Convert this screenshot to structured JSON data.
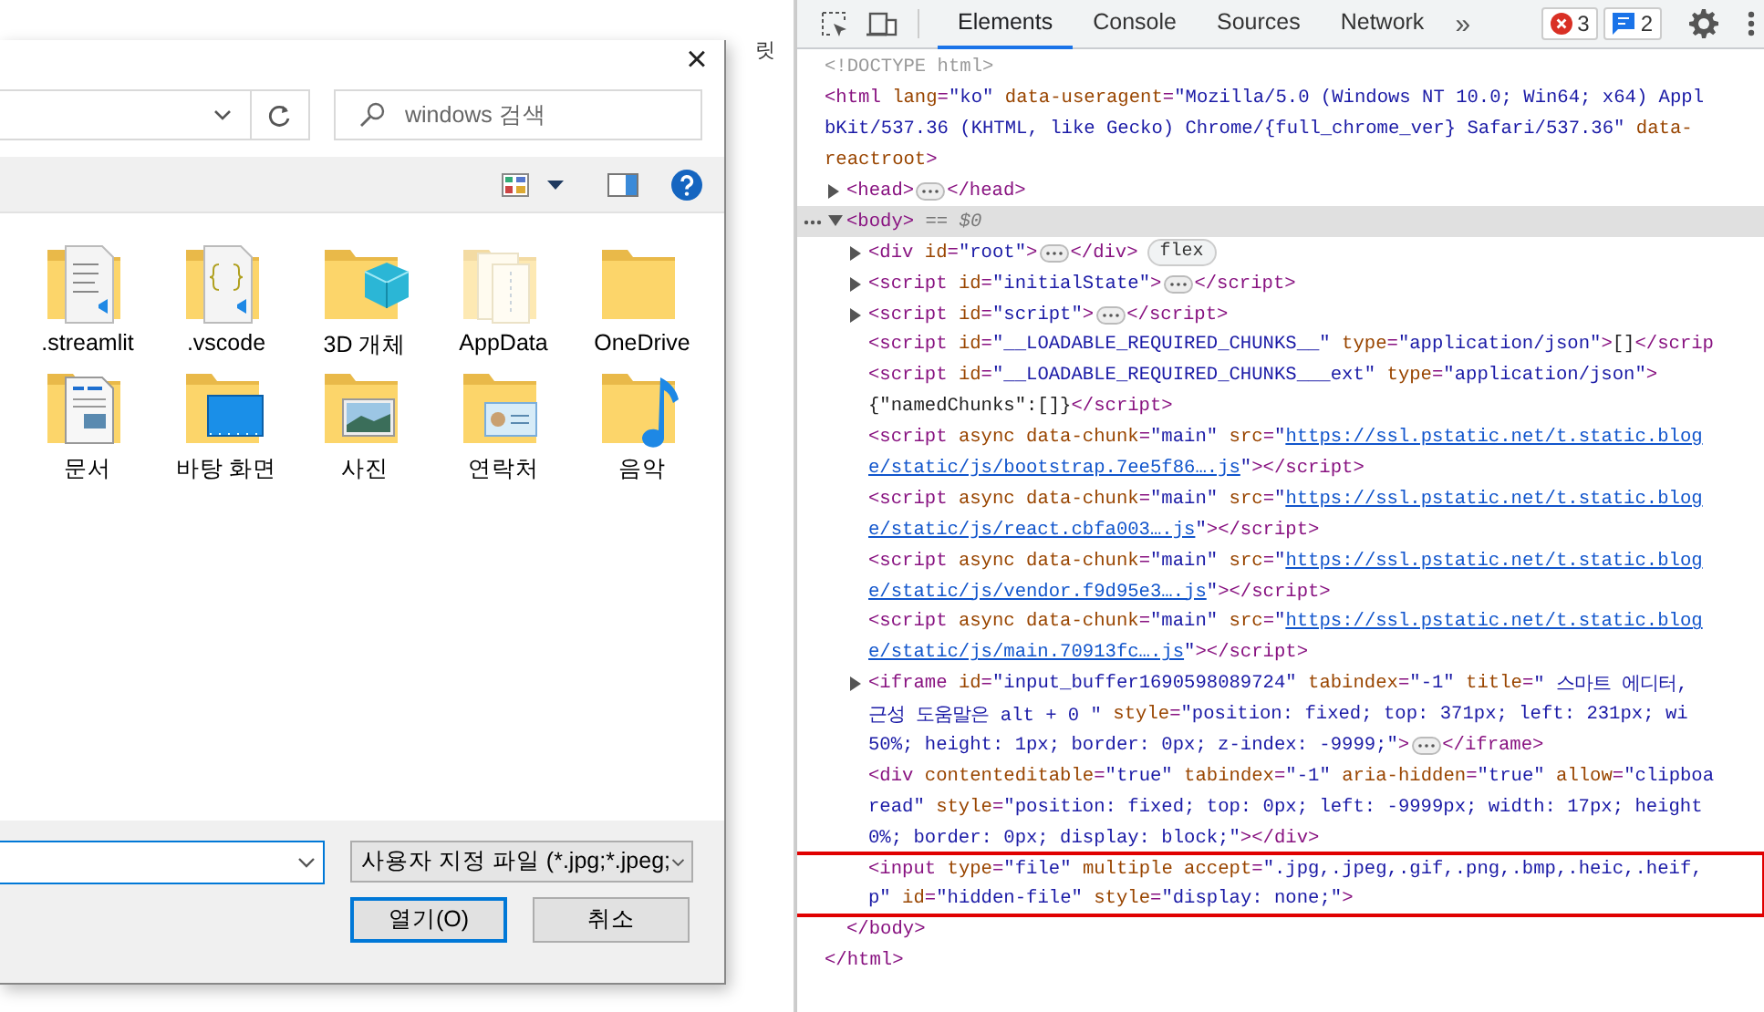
{
  "background_page": {
    "fragments": [
      "릿"
    ]
  },
  "file_dialog": {
    "close_label": "×",
    "search": {
      "placeholder": "windows 검색"
    },
    "items": [
      {
        "label": ".streamlit",
        "kind": "doc-badge",
        "hidden": false
      },
      {
        "label": ".vscode",
        "kind": "braces",
        "hidden": false
      },
      {
        "label": "3D 개체",
        "kind": "cube",
        "hidden": false
      },
      {
        "label": "AppData",
        "kind": "pages",
        "hidden": true
      },
      {
        "label": "OneDrive",
        "kind": "plain",
        "hidden": false
      },
      {
        "label": "문서",
        "kind": "document",
        "hidden": false
      },
      {
        "label": "바탕 화면",
        "kind": "desktop",
        "hidden": false
      },
      {
        "label": "사진",
        "kind": "picture",
        "hidden": false
      },
      {
        "label": "연락처",
        "kind": "contact",
        "hidden": false
      },
      {
        "label": "음악",
        "kind": "music",
        "hidden": false
      }
    ],
    "file_type": "사용자 지정 파일 (*.jpg;*.jpeg;",
    "buttons": [
      {
        "label": "열기(O)",
        "default": true
      },
      {
        "label": "취소",
        "default": false
      }
    ]
  },
  "devtools": {
    "tabs": [
      {
        "label": "Elements",
        "selected": true
      },
      {
        "label": "Console",
        "selected": false
      },
      {
        "label": "Sources",
        "selected": false
      },
      {
        "label": "Network",
        "selected": false
      }
    ],
    "more_tabs": "»",
    "errors": "3",
    "messages": "2",
    "dom": [
      {
        "lines": [
          [
            {
              "kind": "comment",
              "text": "<!DOCTYPE html>"
            }
          ]
        ]
      },
      {
        "lines": [
          [
            {
              "kind": "tag",
              "text": "<html "
            },
            {
              "kind": "attr",
              "text": "lang"
            },
            {
              "kind": "tag",
              "text": "="
            },
            {
              "kind": "value",
              "text": "\"ko\" "
            },
            {
              "kind": "attr",
              "text": "data-useragent"
            },
            {
              "kind": "tag",
              "text": "="
            },
            {
              "kind": "value",
              "text": "\"Mozilla/5.0 (Windows NT 10.0; Win64; x64) Appl"
            }
          ],
          [
            {
              "kind": "value",
              "text": "bKit/537.36 (KHTML, like Gecko) Chrome/{full_chrome_ver} Safari/537.36\" "
            },
            {
              "kind": "attr",
              "text": "data-"
            }
          ],
          [
            {
              "kind": "attr",
              "text": "reactroot"
            },
            {
              "kind": "tag",
              "text": ">"
            }
          ]
        ],
        "children": [
          {
            "expanded": false,
            "lines": [
              [
                {
                  "kind": "tag",
                  "text": "<head>"
                },
                {
                  "kind": "ellipsis"
                },
                {
                  "kind": "tag",
                  "text": "</head>"
                }
              ]
            ]
          },
          {
            "expanded": true,
            "selected": true,
            "lines": [
              [
                {
                  "kind": "tag",
                  "text": "<body>"
                },
                {
                  "kind": "hint",
                  "text": " == $0"
                }
              ]
            ],
            "children": [
              {
                "expanded": false,
                "lines": [
                  [
                    {
                      "kind": "tag",
                      "text": "<div "
                    },
                    {
                      "kind": "attr",
                      "text": "id"
                    },
                    {
                      "kind": "tag",
                      "text": "="
                    },
                    {
                      "kind": "value",
                      "text": "\"root\""
                    },
                    {
                      "kind": "tag",
                      "text": ">"
                    },
                    {
                      "kind": "ellipsis"
                    },
                    {
                      "kind": "tag",
                      "text": "</div>"
                    },
                    {
                      "kind": "badge",
                      "text": "flex"
                    }
                  ]
                ]
              },
              {
                "expanded": false,
                "lines": [
                  [
                    {
                      "kind": "tag",
                      "text": "<script "
                    },
                    {
                      "kind": "attr",
                      "text": "id"
                    },
                    {
                      "kind": "tag",
                      "text": "="
                    },
                    {
                      "kind": "value",
                      "text": "\"initialState\""
                    },
                    {
                      "kind": "tag",
                      "text": ">"
                    },
                    {
                      "kind": "ellipsis"
                    },
                    {
                      "kind": "tag",
                      "text": "</script>"
                    }
                  ]
                ]
              },
              {
                "expanded": false,
                "lines": [
                  [
                    {
                      "kind": "tag",
                      "text": "<script "
                    },
                    {
                      "kind": "attr",
                      "text": "id"
                    },
                    {
                      "kind": "tag",
                      "text": "="
                    },
                    {
                      "kind": "value",
                      "text": "\"script\""
                    },
                    {
                      "kind": "tag",
                      "text": ">"
                    },
                    {
                      "kind": "ellipsis"
                    },
                    {
                      "kind": "tag",
                      "text": "</script>"
                    }
                  ]
                ]
              },
              {
                "lines": [
                  [
                    {
                      "kind": "tag",
                      "text": "<script "
                    },
                    {
                      "kind": "attr",
                      "text": "id"
                    },
                    {
                      "kind": "tag",
                      "text": "="
                    },
                    {
                      "kind": "value",
                      "text": "\"__LOADABLE_REQUIRED_CHUNKS__\" "
                    },
                    {
                      "kind": "attr",
                      "text": "type"
                    },
                    {
                      "kind": "tag",
                      "text": "="
                    },
                    {
                      "kind": "value",
                      "text": "\"application/json\""
                    },
                    {
                      "kind": "tag",
                      "text": ">"
                    },
                    {
                      "kind": "text",
                      "text": "[]"
                    },
                    {
                      "kind": "tag",
                      "text": "</scrip"
                    }
                  ]
                ]
              },
              {
                "lines": [
                  [
                    {
                      "kind": "tag",
                      "text": "<script "
                    },
                    {
                      "kind": "attr",
                      "text": "id"
                    },
                    {
                      "kind": "tag",
                      "text": "="
                    },
                    {
                      "kind": "value",
                      "text": "\"__LOADABLE_REQUIRED_CHUNKS___ext\" "
                    },
                    {
                      "kind": "attr",
                      "text": "type"
                    },
                    {
                      "kind": "tag",
                      "text": "="
                    },
                    {
                      "kind": "value",
                      "text": "\"application/json\""
                    },
                    {
                      "kind": "tag",
                      "text": ">"
                    }
                  ],
                  [
                    {
                      "kind": "text",
                      "text": "{\"namedChunks\":[]}"
                    },
                    {
                      "kind": "tag",
                      "text": "</script>"
                    }
                  ]
                ]
              },
              {
                "lines": [
                  [
                    {
                      "kind": "tag",
                      "text": "<script "
                    },
                    {
                      "kind": "attr",
                      "text": "async data-chunk"
                    },
                    {
                      "kind": "tag",
                      "text": "="
                    },
                    {
                      "kind": "value",
                      "text": "\"main\" "
                    },
                    {
                      "kind": "attr",
                      "text": "src"
                    },
                    {
                      "kind": "tag",
                      "text": "="
                    },
                    {
                      "kind": "value",
                      "text": "\""
                    },
                    {
                      "kind": "link",
                      "text": "https://ssl.pstatic.net/t.static.blog"
                    }
                  ],
                  [
                    {
                      "kind": "link",
                      "text": "e/static/js/bootstrap.7ee5f86….js"
                    },
                    {
                      "kind": "value",
                      "text": "\""
                    },
                    {
                      "kind": "tag",
                      "text": "></script>"
                    }
                  ]
                ]
              },
              {
                "lines": [
                  [
                    {
                      "kind": "tag",
                      "text": "<script "
                    },
                    {
                      "kind": "attr",
                      "text": "async data-chunk"
                    },
                    {
                      "kind": "tag",
                      "text": "="
                    },
                    {
                      "kind": "value",
                      "text": "\"main\" "
                    },
                    {
                      "kind": "attr",
                      "text": "src"
                    },
                    {
                      "kind": "tag",
                      "text": "="
                    },
                    {
                      "kind": "value",
                      "text": "\""
                    },
                    {
                      "kind": "link",
                      "text": "https://ssl.pstatic.net/t.static.blog"
                    }
                  ],
                  [
                    {
                      "kind": "link",
                      "text": "e/static/js/react.cbfa003….js"
                    },
                    {
                      "kind": "value",
                      "text": "\""
                    },
                    {
                      "kind": "tag",
                      "text": "></script>"
                    }
                  ]
                ]
              },
              {
                "lines": [
                  [
                    {
                      "kind": "tag",
                      "text": "<script "
                    },
                    {
                      "kind": "attr",
                      "text": "async data-chunk"
                    },
                    {
                      "kind": "tag",
                      "text": "="
                    },
                    {
                      "kind": "value",
                      "text": "\"main\" "
                    },
                    {
                      "kind": "attr",
                      "text": "src"
                    },
                    {
                      "kind": "tag",
                      "text": "="
                    },
                    {
                      "kind": "value",
                      "text": "\""
                    },
                    {
                      "kind": "link",
                      "text": "https://ssl.pstatic.net/t.static.blog"
                    }
                  ],
                  [
                    {
                      "kind": "link",
                      "text": "e/static/js/vendor.f9d95e3….js"
                    },
                    {
                      "kind": "value",
                      "text": "\""
                    },
                    {
                      "kind": "tag",
                      "text": "></script>"
                    }
                  ]
                ]
              },
              {
                "lines": [
                  [
                    {
                      "kind": "tag",
                      "text": "<script "
                    },
                    {
                      "kind": "attr",
                      "text": "async data-chunk"
                    },
                    {
                      "kind": "tag",
                      "text": "="
                    },
                    {
                      "kind": "value",
                      "text": "\"main\" "
                    },
                    {
                      "kind": "attr",
                      "text": "src"
                    },
                    {
                      "kind": "tag",
                      "text": "="
                    },
                    {
                      "kind": "value",
                      "text": "\""
                    },
                    {
                      "kind": "link",
                      "text": "https://ssl.pstatic.net/t.static.blog"
                    }
                  ],
                  [
                    {
                      "kind": "link",
                      "text": "e/static/js/main.70913fc….js"
                    },
                    {
                      "kind": "value",
                      "text": "\""
                    },
                    {
                      "kind": "tag",
                      "text": "></script>"
                    }
                  ]
                ]
              },
              {
                "expanded": false,
                "lines": [
                  [
                    {
                      "kind": "tag",
                      "text": "<iframe "
                    },
                    {
                      "kind": "attr",
                      "text": "id"
                    },
                    {
                      "kind": "tag",
                      "text": "="
                    },
                    {
                      "kind": "value",
                      "text": "\"input_buffer1690598089724\" "
                    },
                    {
                      "kind": "attr",
                      "text": "tabindex"
                    },
                    {
                      "kind": "tag",
                      "text": "="
                    },
                    {
                      "kind": "value",
                      "text": "\"-1\" "
                    },
                    {
                      "kind": "attr",
                      "text": "title"
                    },
                    {
                      "kind": "tag",
                      "text": "="
                    },
                    {
                      "kind": "value",
                      "text": "\" 스마트 에디터,"
                    }
                  ],
                  [
                    {
                      "kind": "value",
                      "text": "근성 도움말은 alt + 0 \" "
                    },
                    {
                      "kind": "attr",
                      "text": "style"
                    },
                    {
                      "kind": "tag",
                      "text": "="
                    },
                    {
                      "kind": "value",
                      "text": "\"position: fixed; top: 371px; left: 231px; wi"
                    }
                  ],
                  [
                    {
                      "kind": "value",
                      "text": "50%; height: 1px; border: 0px; z-index: -9999;\""
                    },
                    {
                      "kind": "tag",
                      "text": ">"
                    },
                    {
                      "kind": "ellipsis"
                    },
                    {
                      "kind": "tag",
                      "text": "</iframe>"
                    }
                  ]
                ]
              },
              {
                "lines": [
                  [
                    {
                      "kind": "tag",
                      "text": "<div "
                    },
                    {
                      "kind": "attr",
                      "text": "contenteditable"
                    },
                    {
                      "kind": "tag",
                      "text": "="
                    },
                    {
                      "kind": "value",
                      "text": "\"true\" "
                    },
                    {
                      "kind": "attr",
                      "text": "tabindex"
                    },
                    {
                      "kind": "tag",
                      "text": "="
                    },
                    {
                      "kind": "value",
                      "text": "\"-1\" "
                    },
                    {
                      "kind": "attr",
                      "text": "aria-hidden"
                    },
                    {
                      "kind": "tag",
                      "text": "="
                    },
                    {
                      "kind": "value",
                      "text": "\"true\" "
                    },
                    {
                      "kind": "attr",
                      "text": "allow"
                    },
                    {
                      "kind": "tag",
                      "text": "="
                    },
                    {
                      "kind": "value",
                      "text": "\"clipboa"
                    }
                  ],
                  [
                    {
                      "kind": "value",
                      "text": "read\" "
                    },
                    {
                      "kind": "attr",
                      "text": "style"
                    },
                    {
                      "kind": "tag",
                      "text": "="
                    },
                    {
                      "kind": "value",
                      "text": "\"position: fixed; top: 0px; left: -9999px; width: 17px; height"
                    }
                  ],
                  [
                    {
                      "kind": "value",
                      "text": "0%; border: 0px; display: block;\""
                    },
                    {
                      "kind": "tag",
                      "text": "></div>"
                    }
                  ]
                ]
              },
              {
                "highlighted": true,
                "lines": [
                  [
                    {
                      "kind": "tag",
                      "text": "<input "
                    },
                    {
                      "kind": "attr",
                      "text": "type"
                    },
                    {
                      "kind": "tag",
                      "text": "="
                    },
                    {
                      "kind": "value",
                      "text": "\"file\" "
                    },
                    {
                      "kind": "attr",
                      "text": "multiple accept"
                    },
                    {
                      "kind": "tag",
                      "text": "="
                    },
                    {
                      "kind": "value",
                      "text": "\".jpg,.jpeg,.gif,.png,.bmp,.heic,.heif,"
                    }
                  ],
                  [
                    {
                      "kind": "value",
                      "text": "p\" "
                    },
                    {
                      "kind": "attr",
                      "text": "id"
                    },
                    {
                      "kind": "tag",
                      "text": "="
                    },
                    {
                      "kind": "value",
                      "text": "\"hidden-file\" "
                    },
                    {
                      "kind": "attr",
                      "text": "style"
                    },
                    {
                      "kind": "tag",
                      "text": "="
                    },
                    {
                      "kind": "value",
                      "text": "\"display: none;\""
                    },
                    {
                      "kind": "tag",
                      "text": ">"
                    }
                  ]
                ]
              }
            ],
            "closing": [
              {
                "kind": "tag",
                "text": "</body>"
              }
            ]
          }
        ],
        "closing": [
          {
            "kind": "tag",
            "text": "</html>"
          }
        ]
      }
    ]
  }
}
